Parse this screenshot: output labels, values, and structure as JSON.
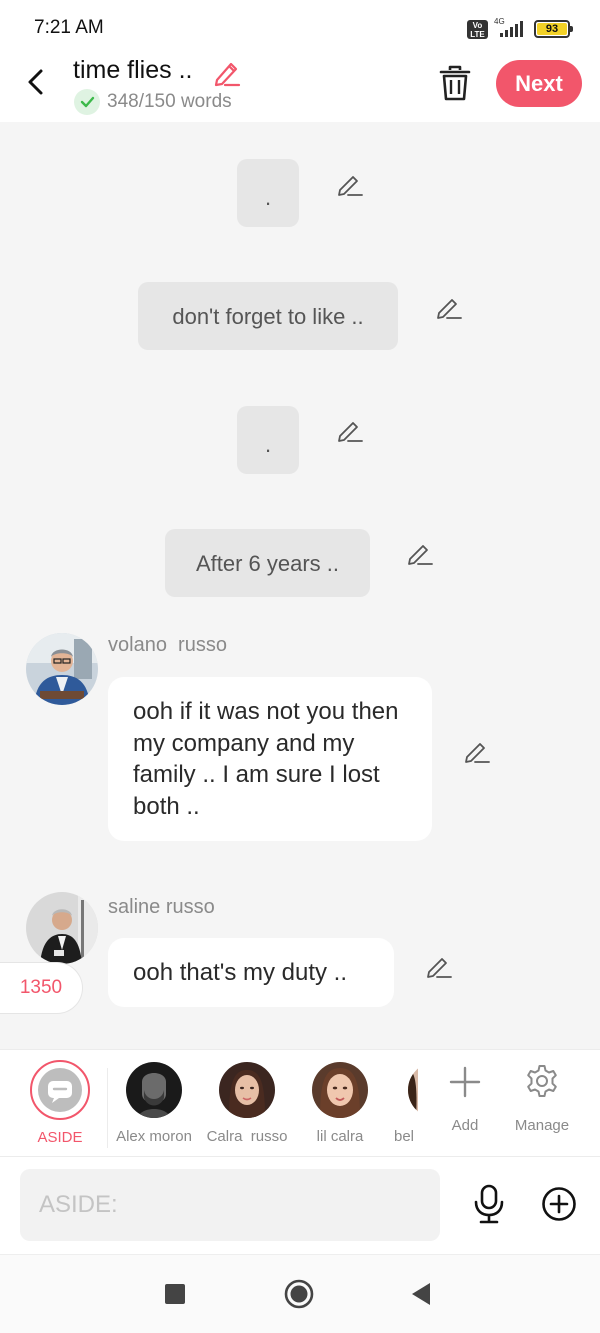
{
  "status_bar": {
    "time": "7:21 AM",
    "volte": "Vo LTE",
    "network": "4G",
    "battery": "93"
  },
  "header": {
    "title": "time flies ..",
    "word_count": "348/150 words",
    "next_label": "Next"
  },
  "chat": {
    "narrations": [
      {
        "text": "."
      },
      {
        "text": "don't forget to like .."
      },
      {
        "text": "."
      },
      {
        "text": "After 6 years .."
      }
    ],
    "messages": [
      {
        "sender": "volano  russo",
        "text": "ooh if it was not you then my company and my family .. I am sure I lost both .."
      },
      {
        "sender": "saline russo",
        "text": "ooh that's my duty .."
      }
    ],
    "count_badge": "1350"
  },
  "characters": {
    "items": [
      {
        "name": "ASIDE",
        "selected": true
      },
      {
        "name": "Alex moron"
      },
      {
        "name": "Calra  russo"
      },
      {
        "name": "lil calra"
      },
      {
        "name": "bel"
      }
    ],
    "add_label": "Add",
    "manage_label": "Manage"
  },
  "input": {
    "placeholder": "ASIDE:"
  },
  "colors": {
    "accent": "#f2566b",
    "chat_background": "#f5f5f5",
    "narration_background": "#e6e6e6",
    "check_green": "#3cb94a"
  }
}
